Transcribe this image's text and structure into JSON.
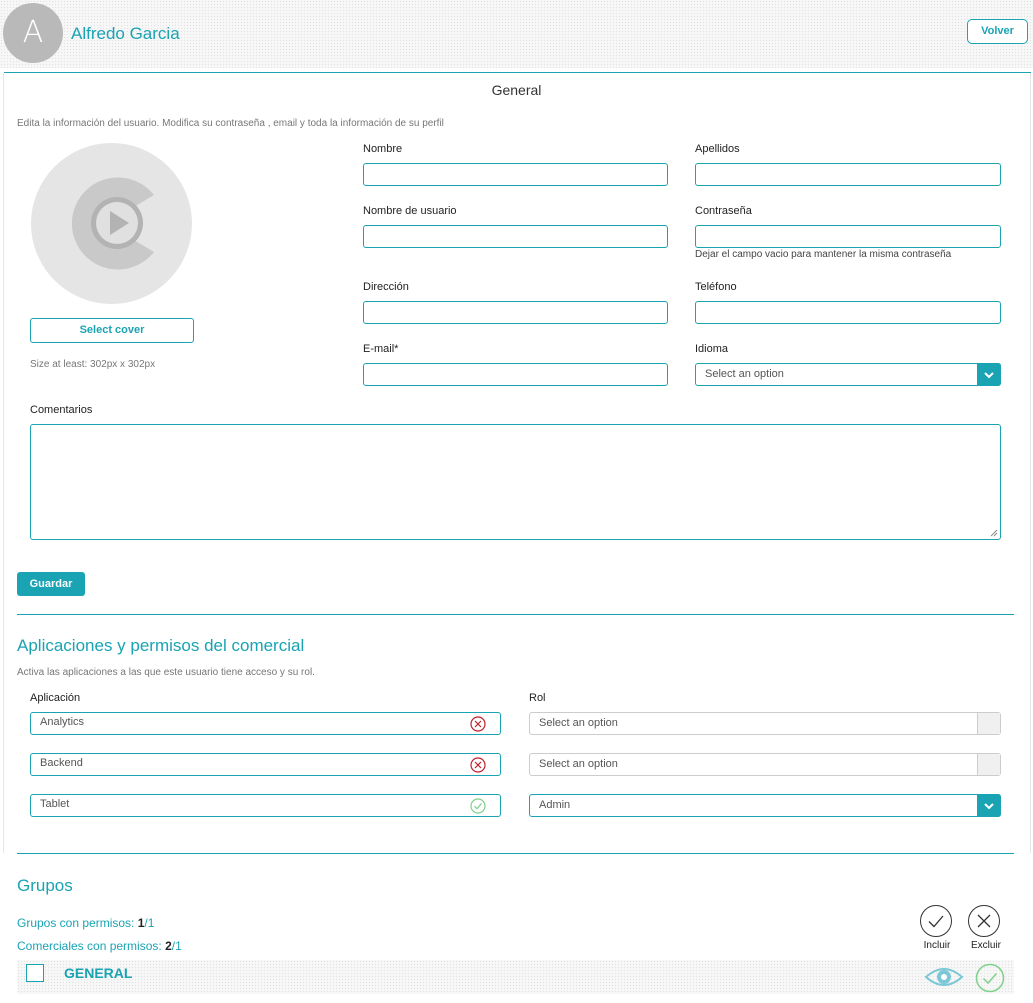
{
  "header": {
    "avatar_letter": "A",
    "user_name": "Alfredo Garcia",
    "back_label": "Volver"
  },
  "general": {
    "title": "General",
    "description": "Edita la información del usuario. Modifica su contraseña , email y toda la información de su perfil",
    "select_cover_label": "Select cover",
    "cover_hint": "Size at least: 302px x 302px",
    "fields": {
      "nombre": {
        "label": "Nombre",
        "value": ""
      },
      "apellidos": {
        "label": "Apellidos",
        "value": ""
      },
      "usuario": {
        "label": "Nombre de usuario",
        "value": ""
      },
      "contrasena": {
        "label": "Contraseña",
        "value": "",
        "hint": "Dejar el campo vacio para mantener la misma contraseña"
      },
      "direccion": {
        "label": "Dirección",
        "value": ""
      },
      "telefono": {
        "label": "Teléfono",
        "value": ""
      },
      "email": {
        "label": "E-mail*",
        "value": ""
      },
      "idioma": {
        "label": "Idioma",
        "value": "Select an option"
      },
      "comentarios": {
        "label": "Comentarios",
        "value": ""
      }
    },
    "save_label": "Guardar"
  },
  "apps": {
    "title": "Aplicaciones y permisos del comercial",
    "description": "Activa las aplicaciones a las que este usuario tiene acceso y su rol.",
    "col_app": "Aplicación",
    "col_role": "Rol",
    "rows": [
      {
        "app": "Analytics",
        "status": "remove",
        "role": "Select an option",
        "role_enabled": false
      },
      {
        "app": "Backend",
        "status": "remove",
        "role": "Select an option",
        "role_enabled": false
      },
      {
        "app": "Tablet",
        "status": "active",
        "role": "Admin",
        "role_enabled": true
      }
    ]
  },
  "groups": {
    "title": "Grupos",
    "groups_label": "Grupos con permisos:",
    "groups_selected": "1",
    "groups_total": "/1",
    "commercials_label": "Comerciales con permisos:",
    "commercials_selected": "2",
    "commercials_total": "/1",
    "include_label": "Incluir",
    "exclude_label": "Excluir",
    "items": [
      {
        "name": "GENERAL"
      }
    ]
  },
  "colors": {
    "accent": "#1aa3b3",
    "danger": "#c0202a",
    "success": "#7ed18b"
  }
}
